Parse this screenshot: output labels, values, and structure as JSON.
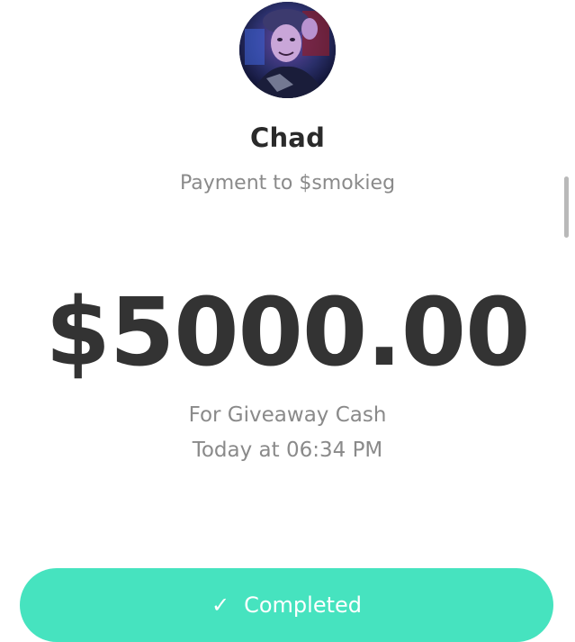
{
  "recipient": {
    "name": "Chad",
    "subtitle": "Payment to $smokieg"
  },
  "payment": {
    "amount": "$5000.00",
    "note": "For Giveaway Cash",
    "time": "Today at 06:34 PM"
  },
  "status": {
    "label": "Completed",
    "icon": "check-icon",
    "check_glyph": "✓",
    "color": "#46e3bf"
  }
}
